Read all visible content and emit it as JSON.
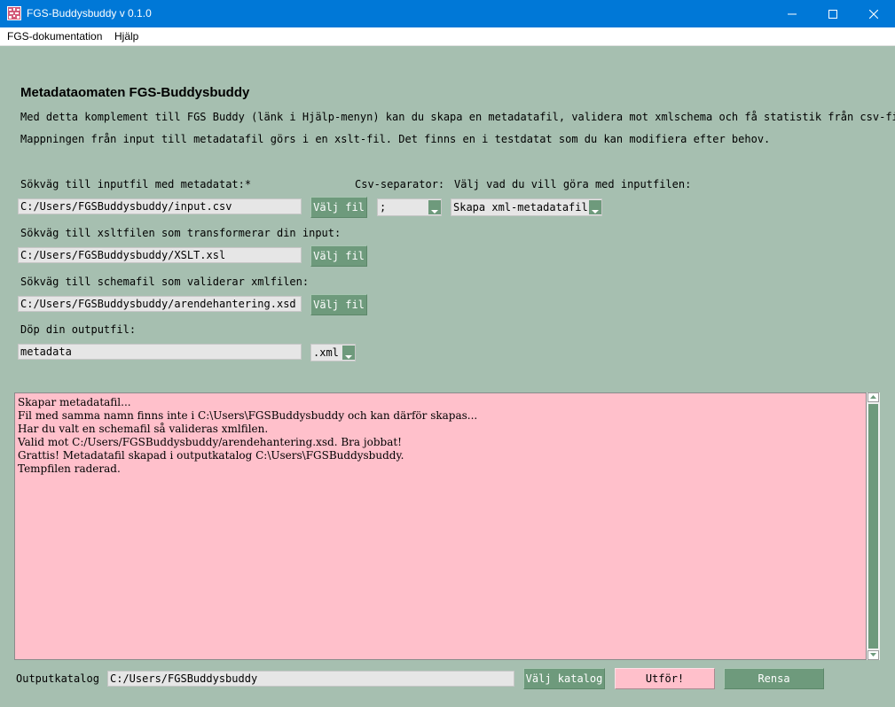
{
  "window": {
    "title": "FGS-Buddysbuddy v 0.1.0"
  },
  "menu": {
    "items": [
      "FGS-dokumentation",
      "Hjälp"
    ]
  },
  "intro": {
    "heading": "Metadataomaten FGS-Buddysbuddy",
    "line1": "Med detta komplement till FGS Buddy (länk i Hjälp-menyn) kan du skapa en metadatafil, validera mot xmlschema och få statistik från csv-fil",
    "line2": "Mappningen från input till metadatafil görs i en xslt-fil. Det finns en i testdatat som du kan modifiera efter behov."
  },
  "input": {
    "label": "Sökväg till inputfil med metadatat:*",
    "value": "C:/Users/FGSBuddysbuddy/input.csv",
    "button": "Välj fil"
  },
  "separator": {
    "label": "Csv-separator:",
    "value": ";"
  },
  "action": {
    "label": "Välj vad du vill göra med inputfilen:",
    "value": "Skapa xml-metadatafil"
  },
  "xslt": {
    "label": "Sökväg till xsltfilen som transformerar din input:",
    "value": "C:/Users/FGSBuddysbuddy/XSLT.xsl",
    "button": "Välj fil"
  },
  "schema": {
    "label": "Sökväg till schemafil som validerar xmlfilen:",
    "value": "C:/Users/FGSBuddysbuddy/arendehantering.xsd",
    "button": "Välj fil"
  },
  "output_file": {
    "label": "Döp din outputfil:",
    "value": "metadata",
    "extension": ".xml"
  },
  "log": {
    "lines": [
      "Skapar metadatafil...",
      "Fil med samma namn finns inte i C:\\Users\\FGSBuddysbuddy och kan därför skapas...",
      "Har du valt en schemafil så valideras xmlfilen.",
      "Valid mot C:/Users/FGSBuddysbuddy/arendehantering.xsd. Bra jobbat!",
      "Grattis! Metadatafil skapad i outputkatalog C:\\Users\\FGSBuddysbuddy.",
      "Tempfilen raderad."
    ]
  },
  "footer": {
    "label": "Outputkatalog",
    "value": "C:/Users/FGSBuddysbuddy",
    "choose_button": "Välj katalog",
    "run_button": "Utför!",
    "clear_button": "Rensa"
  },
  "colors": {
    "background": "#a6bfb0",
    "button": "#6e9a7c",
    "log_bg": "#ffc0cb",
    "run_button_bg": "#ffc0cb",
    "titlebar": "#0078d7"
  },
  "icons": [
    "app-icon",
    "minimize-icon",
    "maximize-icon",
    "close-icon",
    "chevron-down-icon"
  ]
}
